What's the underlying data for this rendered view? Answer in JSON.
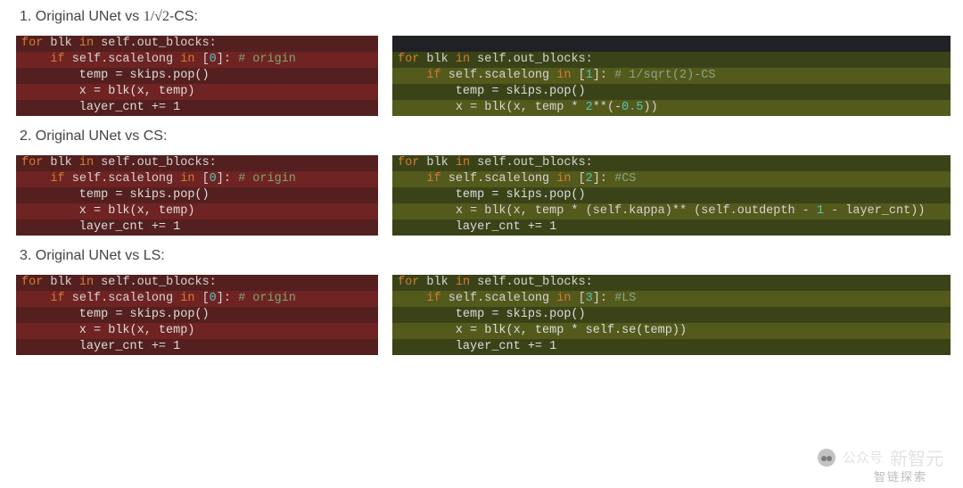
{
  "headings": {
    "h1_pre": "1. Original UNet vs ",
    "h1_math": "1/√2",
    "h1_post": "-CS:",
    "h2": "2. Original UNet vs CS:",
    "h3": "3. Original UNet vs LS:"
  },
  "origin_block": {
    "l0": "for blk in self.out_blocks:",
    "l1": "    if self.scalelong in [0]: ",
    "l1c": "# origin",
    "l2": "        temp = skips.pop()",
    "l3": "        x = blk(x, temp)",
    "l4": "        layer_cnt += 1"
  },
  "cs_sqrt2_block": {
    "l0": "for blk in self.out_blocks:",
    "l1": "    if self.scalelong in [1]: ",
    "l1c": "# 1/sqrt(2)-CS",
    "l2": "        temp = skips.pop()",
    "l3": "        x = blk(x, temp * 2**(-0.5))"
  },
  "cs_block": {
    "l0": "for blk in self.out_blocks:",
    "l1": "    if self.scalelong in [2]: ",
    "l1c": "#CS",
    "l2": "        temp = skips.pop()",
    "l3": "        x = blk(x, temp * (self.kappa)** (self.outdepth - 1 - layer_cnt))",
    "l4": "        layer_cnt += 1"
  },
  "ls_block": {
    "l0": "for blk in self.out_blocks:",
    "l1": "    if self.scalelong in [3]: ",
    "l1c": "#LS",
    "l2": "        temp = skips.pop()",
    "l3": "        x = blk(x, temp * self.se(temp))",
    "l4": "        layer_cnt += 1"
  },
  "widths": {
    "origin": "406px",
    "sqrt2": "626px",
    "cs": "626px",
    "ls": "626px"
  },
  "watermark": {
    "prefix": "公众号",
    "name": "新智元",
    "sub": "智链探索"
  }
}
